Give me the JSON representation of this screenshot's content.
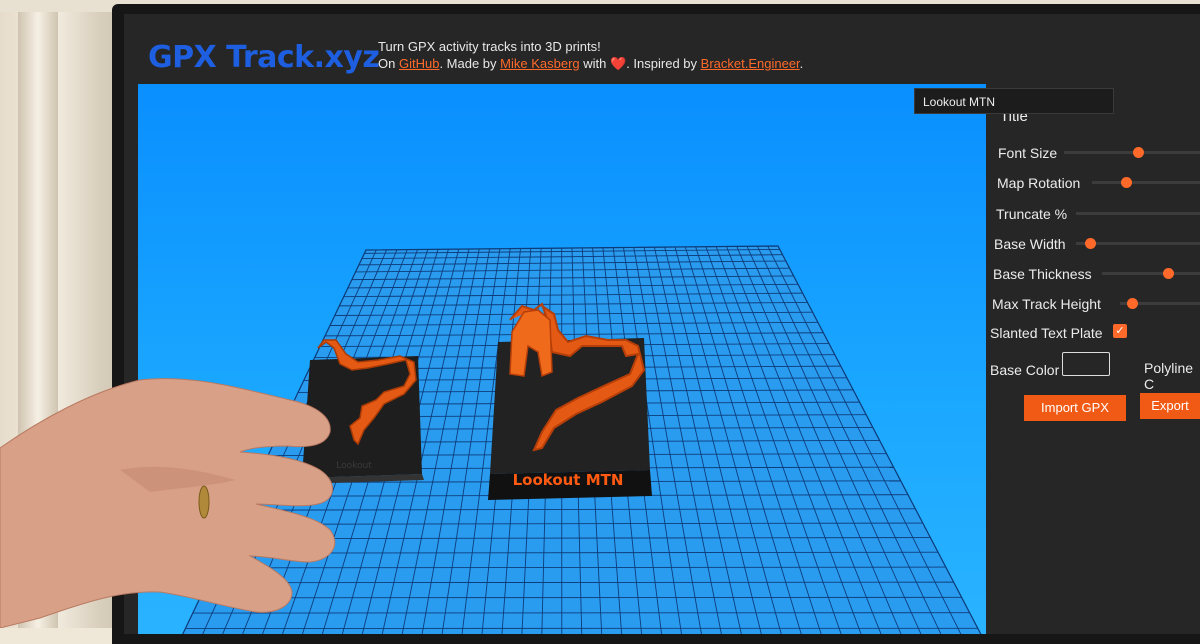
{
  "app": {
    "logo": "GPX Track.xyz",
    "tagline_line1": "Turn GPX activity tracks into 3D prints!",
    "tagline_on": "On",
    "tagline_github": "GitHub",
    "tagline_made_by": ". Made by",
    "tagline_author": "Mike Kasberg",
    "tagline_with": "with",
    "tagline_heart": "❤️",
    "tagline_inspired": ". Inspired by",
    "tagline_inspired_link": "Bracket.Engineer",
    "tagline_end": "."
  },
  "viewport": {
    "model_label": "Lookout MTN",
    "held_print_label": "Lookout"
  },
  "panel": {
    "title_label": "Title",
    "title_value": "Lookout MTN",
    "font_size_label": "Font Size",
    "font_size_value": 0.55,
    "map_rotation_label": "Map Rotation",
    "map_rotation_value": 0.3,
    "truncate_label": "Truncate %",
    "truncate_value": 0,
    "base_width_label": "Base Width",
    "base_width_value": 0.08,
    "base_thickness_label": "Base Thickness",
    "base_thickness_value": 0.7,
    "max_track_height_label": "Max Track Height",
    "max_track_height_value": 0.1,
    "slanted_label": "Slanted Text Plate",
    "slanted_checked": true,
    "check_mark": "✓",
    "base_color_label": "Base Color",
    "polyline_label": "Polyline C",
    "import_button": "Import GPX",
    "export_button": "Export"
  },
  "colors": {
    "accent": "#f05a14",
    "logo": "#1d5fe0",
    "viewport_bg": "#1aa7ff",
    "panel_bg": "#262626"
  }
}
